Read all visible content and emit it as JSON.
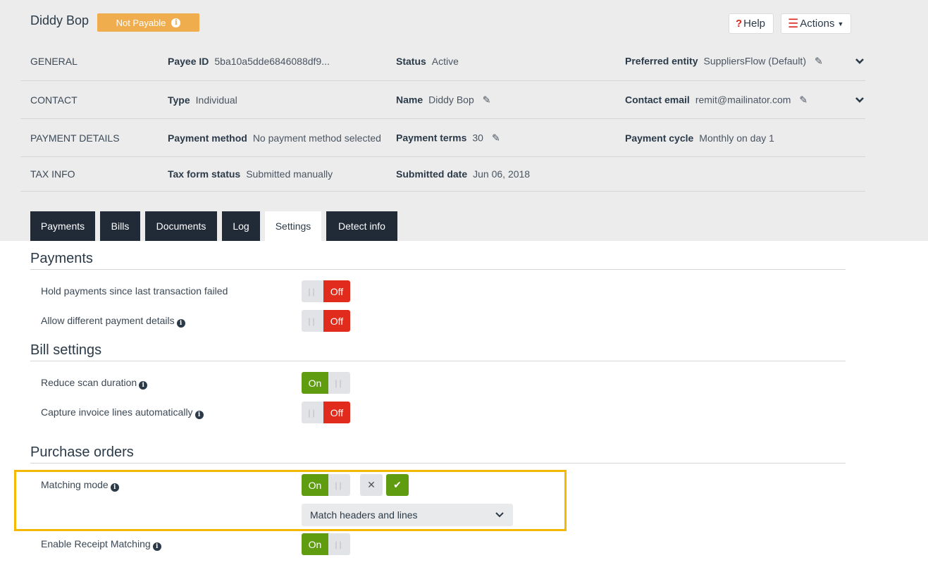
{
  "header": {
    "payee_name": "Diddy Bop",
    "status_badge": "Not Payable",
    "help_label": "Help",
    "actions_label": "Actions"
  },
  "details": {
    "general": {
      "section": "GENERAL",
      "payee_id_label": "Payee ID",
      "payee_id": "5ba10a5dde6846088df9...",
      "status_label": "Status",
      "status": "Active",
      "entity_label": "Preferred entity",
      "entity": "SuppliersFlow (Default)"
    },
    "contact": {
      "section": "CONTACT",
      "type_label": "Type",
      "type": "Individual",
      "name_label": "Name",
      "name": "Diddy Bop",
      "email_label": "Contact email",
      "email": "remit@mailinator.com"
    },
    "payment": {
      "section": "PAYMENT DETAILS",
      "method_label": "Payment method",
      "method": "No payment method selected",
      "terms_label": "Payment terms",
      "terms": "30",
      "cycle_label": "Payment cycle",
      "cycle": "Monthly on day 1"
    },
    "tax": {
      "section": "TAX INFO",
      "form_label": "Tax form status",
      "form": "Submitted manually",
      "date_label": "Submitted date",
      "date": "Jun 06, 2018"
    }
  },
  "tabs": [
    "Payments",
    "Bills",
    "Documents",
    "Log",
    "Settings",
    "Detect info"
  ],
  "active_tab": "Settings",
  "settings": {
    "payments_title": "Payments",
    "hold_payments": {
      "label": "Hold payments since last transaction failed",
      "state": "Off"
    },
    "allow_different": {
      "label": "Allow different payment details",
      "state": "Off"
    },
    "bill_title": "Bill settings",
    "reduce_scan": {
      "label": "Reduce scan duration",
      "state": "On"
    },
    "capture_lines": {
      "label": "Capture invoice lines automatically",
      "state": "Off"
    },
    "po_title": "Purchase orders",
    "matching_mode": {
      "label": "Matching mode",
      "state": "On",
      "selected": "Match headers and lines"
    },
    "receipt_matching": {
      "label": "Enable Receipt Matching",
      "state": "On"
    }
  },
  "colors": {
    "off": "#e12b1c",
    "on": "#5f9c0f",
    "badge": "#f0ad4e",
    "highlight": "#f5b800",
    "tab_dark": "#212a37"
  },
  "icons": [
    "info-icon",
    "question-icon",
    "menu-icon",
    "pencil-icon",
    "chevron-down-icon",
    "grip-icon",
    "close-icon",
    "check-icon"
  ]
}
